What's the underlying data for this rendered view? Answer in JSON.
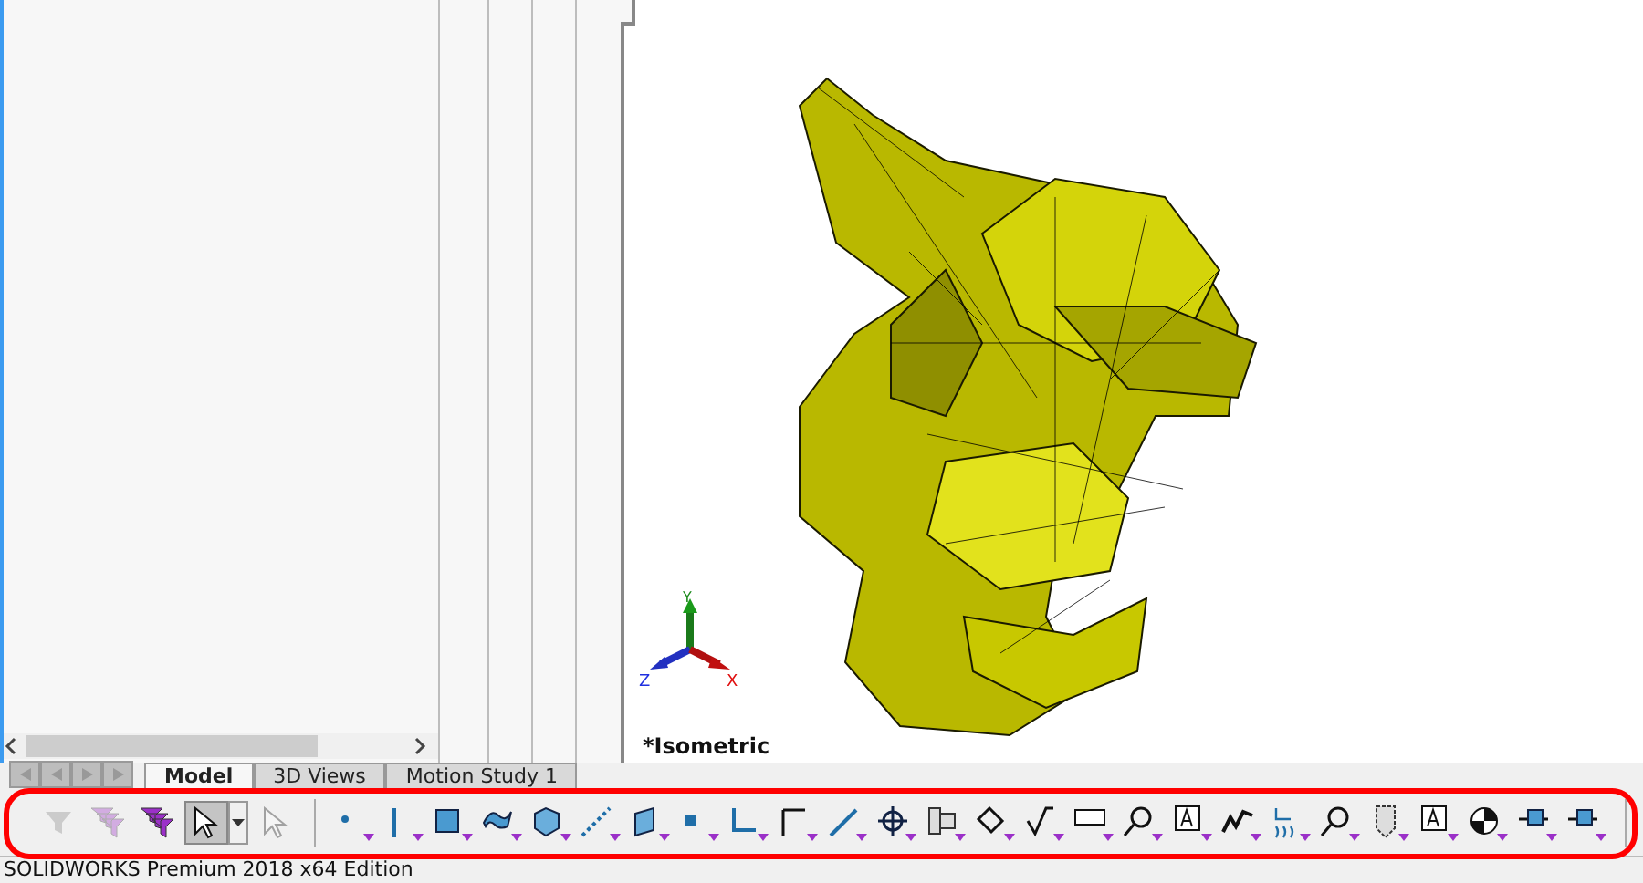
{
  "view": {
    "orientation_label": "*Isometric",
    "triad": {
      "x": "X",
      "y": "Y",
      "z": "Z"
    }
  },
  "tabs": [
    {
      "label": "Model",
      "selected": true
    },
    {
      "label": "3D Views",
      "selected": false
    },
    {
      "label": "Motion Study 1",
      "selected": false
    }
  ],
  "toolbar": {
    "buttons": [
      {
        "kind": "funnel",
        "disabled": true,
        "selected": false
      },
      {
        "kind": "funnels",
        "disabled": true,
        "selected": false
      },
      {
        "kind": "funnels",
        "disabled": false,
        "selected": false
      },
      {
        "kind": "cursor",
        "disabled": false,
        "selected": true
      },
      {
        "kind": "caret",
        "disabled": false,
        "selected": false
      },
      {
        "kind": "cursor",
        "disabled": true,
        "selected": false
      },
      {
        "kind": "point",
        "disabled": false,
        "selected": false
      },
      {
        "kind": "vline",
        "disabled": false,
        "selected": false
      },
      {
        "kind": "square",
        "disabled": false,
        "selected": false
      },
      {
        "kind": "surface",
        "disabled": false,
        "selected": false
      },
      {
        "kind": "cube",
        "disabled": false,
        "selected": false
      },
      {
        "kind": "dashed",
        "disabled": false,
        "selected": false
      },
      {
        "kind": "plane",
        "disabled": false,
        "selected": false
      },
      {
        "kind": "smallsquare",
        "disabled": false,
        "selected": false
      },
      {
        "kind": "corner",
        "disabled": false,
        "selected": false
      },
      {
        "kind": "segment",
        "disabled": false,
        "selected": false
      },
      {
        "kind": "diagonal",
        "disabled": false,
        "selected": false
      },
      {
        "kind": "target",
        "disabled": false,
        "selected": false
      },
      {
        "kind": "block",
        "disabled": false,
        "selected": false
      },
      {
        "kind": "tag",
        "disabled": false,
        "selected": false
      },
      {
        "kind": "check",
        "disabled": false,
        "selected": false
      },
      {
        "kind": "frame",
        "disabled": false,
        "selected": false
      },
      {
        "kind": "magnifier",
        "disabled": false,
        "selected": false
      },
      {
        "kind": "letter",
        "disabled": false,
        "selected": false
      },
      {
        "kind": "zigzag",
        "disabled": false,
        "selected": false
      },
      {
        "kind": "waves",
        "disabled": false,
        "selected": false
      },
      {
        "kind": "magnifier",
        "disabled": false,
        "selected": false
      },
      {
        "kind": "pencil",
        "disabled": false,
        "selected": false
      },
      {
        "kind": "letter",
        "disabled": false,
        "selected": false
      },
      {
        "kind": "mass",
        "disabled": false,
        "selected": false
      },
      {
        "kind": "pin",
        "disabled": false,
        "selected": false
      },
      {
        "kind": "pin",
        "disabled": false,
        "selected": false
      }
    ]
  },
  "status_bar": {
    "text": "SOLIDWORKS Premium 2018 x64 Edition"
  }
}
